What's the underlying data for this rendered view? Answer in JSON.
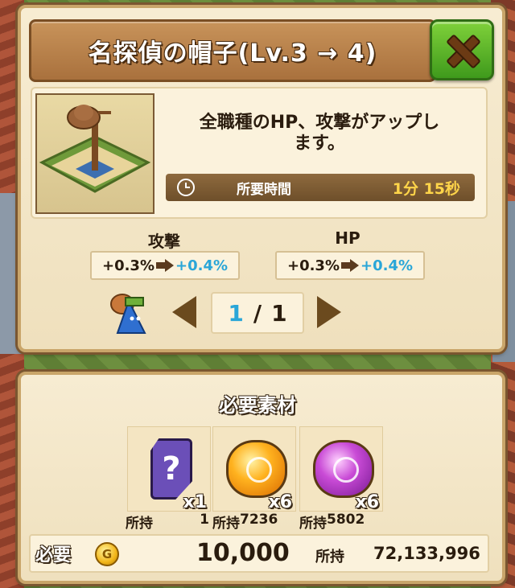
{
  "dialog": {
    "title": "名探偵の帽子(Lv.3 → 4)",
    "description_line1": "全職種のHP、攻撃がアップし",
    "description_line2": "ます。",
    "time_label": "所要時間",
    "time_value": "1分 15秒"
  },
  "stats": [
    {
      "label": "攻撃",
      "from": "+0.3%",
      "to": "+0.4%"
    },
    {
      "label": "HP",
      "from": "+0.3%",
      "to": "+0.4%"
    }
  ],
  "pager": {
    "current": "1",
    "separator": "/",
    "total": "1"
  },
  "materials": {
    "title": "必要素材",
    "own_label": "所持",
    "items": [
      {
        "icon": "mystery-item-icon",
        "count": "x1",
        "owned": "1"
      },
      {
        "icon": "orange-gem-icon",
        "count": "x6",
        "owned": "7236"
      },
      {
        "icon": "purple-gem-icon",
        "count": "x6",
        "owned": "5802"
      }
    ]
  },
  "cost": {
    "need_label": "必要",
    "coin_symbol": "G",
    "need_value": "10,000",
    "own_label": "所持",
    "own_value": "72,133,996"
  },
  "colors": {
    "accent_blue": "#2aa6d8",
    "close_green": "#3f9a1c",
    "parchment": "#f7ecd2"
  }
}
